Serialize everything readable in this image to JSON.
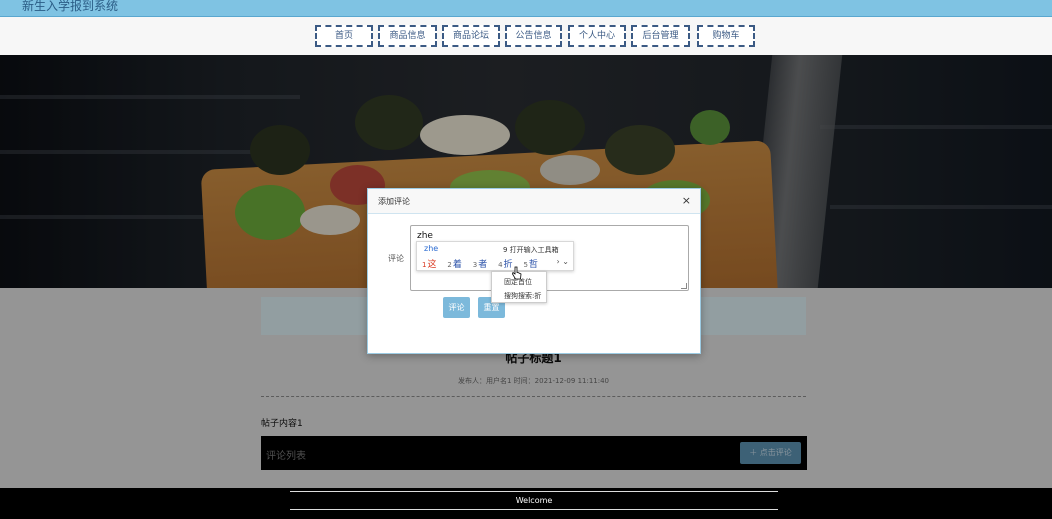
{
  "app": {
    "title": "新生入学报到系统"
  },
  "nav": {
    "items": [
      {
        "label": "首页"
      },
      {
        "label": "商品信息"
      },
      {
        "label": "商品论坛"
      },
      {
        "label": "公告信息"
      },
      {
        "label": "个人中心"
      },
      {
        "label": "后台管理"
      },
      {
        "label": "购物车"
      }
    ]
  },
  "post": {
    "title": "帖子标题1",
    "meta": "发布人：用户名1 时间：2021-12-09 11:11:40",
    "content": "帖子内容1"
  },
  "comments": {
    "header": "评论列表",
    "add_button": "点击评论",
    "add_icon": "plus-icon"
  },
  "footer": {
    "welcome": "Welcome"
  },
  "modal": {
    "title": "添加评论",
    "close_glyph": "×",
    "field_label": "评论",
    "textarea_value": "zhe",
    "submit_label": "评论",
    "reset_label": "重置"
  },
  "ime": {
    "pinyin": "zhe",
    "tool_hint": "9 打开输入工具箱",
    "candidates": [
      {
        "num": "1",
        "word": "这"
      },
      {
        "num": "2",
        "word": "着"
      },
      {
        "num": "3",
        "word": "者"
      },
      {
        "num": "4",
        "word": "折"
      },
      {
        "num": "5",
        "word": "哲"
      }
    ],
    "more_glyph": "› ⌄",
    "menu": [
      "固定首位",
      "搜狗搜索:折"
    ]
  },
  "colors": {
    "topbar": "#7fc3e3",
    "nav_border": "#3b5a84",
    "button": "#7cb9db",
    "ime_first": "#d9361e"
  }
}
